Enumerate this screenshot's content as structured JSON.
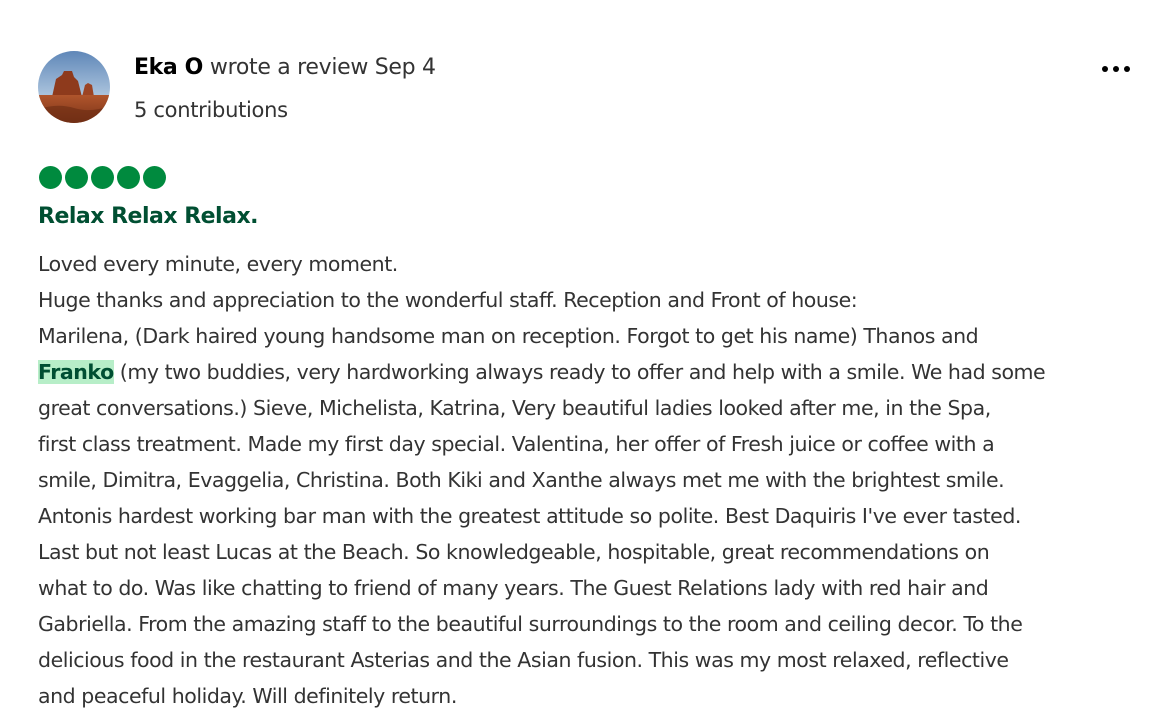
{
  "author": {
    "name": "Eka O",
    "action": "wrote a review Sep 4",
    "contributions": "5 contributions",
    "avatar_icon": "avatar-photo-icon"
  },
  "menu": {
    "icon": "more-options-icon"
  },
  "rating": {
    "value": 5,
    "max": 5,
    "color": "#008a3e"
  },
  "review": {
    "title": "Relax Relax Relax.",
    "highlight_color": "#b7eec8",
    "lines": [
      {
        "text": "Loved every minute, every moment."
      },
      {
        "text": "Huge thanks and appreciation to the wonderful staff. Reception and Front of house:"
      },
      {
        "text": "Marilena, (Dark haired young handsome man on reception. Forgot to get his name) Thanos and"
      },
      {
        "highlight": "Franko",
        "text": " (my two buddies, very hardworking always ready to offer and help with a smile. We had some"
      },
      {
        "text": "great conversations.) Sieve, Michelista, Katrina, Very beautiful ladies looked after me, in the Spa,"
      },
      {
        "text": "first class treatment. Made my first day special. Valentina, her offer of Fresh juice or coffee with a"
      },
      {
        "text": "smile, Dimitra, Evaggelia, Christina. Both Kiki and Xanthe always met me with the brightest smile."
      },
      {
        "text": "Antonis hardest working bar man with the greatest attitude so polite. Best Daquiris I've ever tasted."
      },
      {
        "text": "Last but not least Lucas at the Beach. So knowledgeable, hospitable, great recommendations on"
      },
      {
        "text": "what to do. Was like chatting to friend of many years. The Guest Relations lady with red hair and"
      },
      {
        "text": "Gabriella. From the amazing staff to the beautiful surroundings to the room and ceiling decor. To the"
      },
      {
        "text": "delicious food in the restaurant Asterias and the Asian fusion. This was my most relaxed, reflective"
      },
      {
        "text": "and peaceful holiday. Will definitely return."
      }
    ]
  }
}
